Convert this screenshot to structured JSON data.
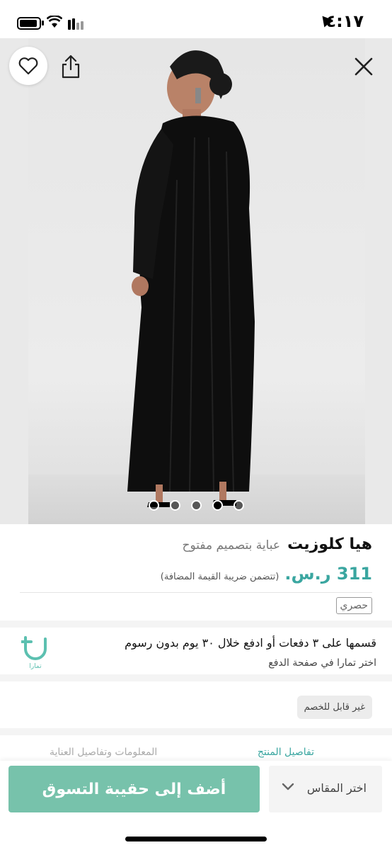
{
  "status_bar": {
    "time": "٤:١٧",
    "icons": [
      "location-icon",
      "battery-icon",
      "wifi-icon",
      "signal-icon"
    ]
  },
  "gallery": {
    "image_alt": "model-wearing-black-abaya",
    "dots_count": 5,
    "active_dot": 3
  },
  "actions": {
    "wishlist_icon": "heart-icon",
    "share_icon": "share-icon",
    "close_icon": "close-icon"
  },
  "product": {
    "brand": "هيا كلوزيت",
    "name": "عباية بتصميم مفتوح",
    "price": "311 ر.س.",
    "vat_note": "(تتضمن ضريبة القيمة المضافة)",
    "badge": "حصري"
  },
  "tamara": {
    "line1": "قسمها على ٣ دفعات أو ادفع خلال ٣٠ يوم بدون رسوم",
    "line2": "اختر تمارا في صفحة الدفع",
    "logo_text": "تمارا"
  },
  "discount_note": "غير قابل للخصم",
  "tabs": {
    "details": "تفاصيل المنتج",
    "info": "المعلومات وتفاصيل العناية"
  },
  "bottom": {
    "add_to_bag": "أضف إلى حقيبة التسوق",
    "size_select": "اختر المقاس"
  },
  "colors": {
    "accent": "#3aa6a0",
    "button": "#77c2ab"
  }
}
